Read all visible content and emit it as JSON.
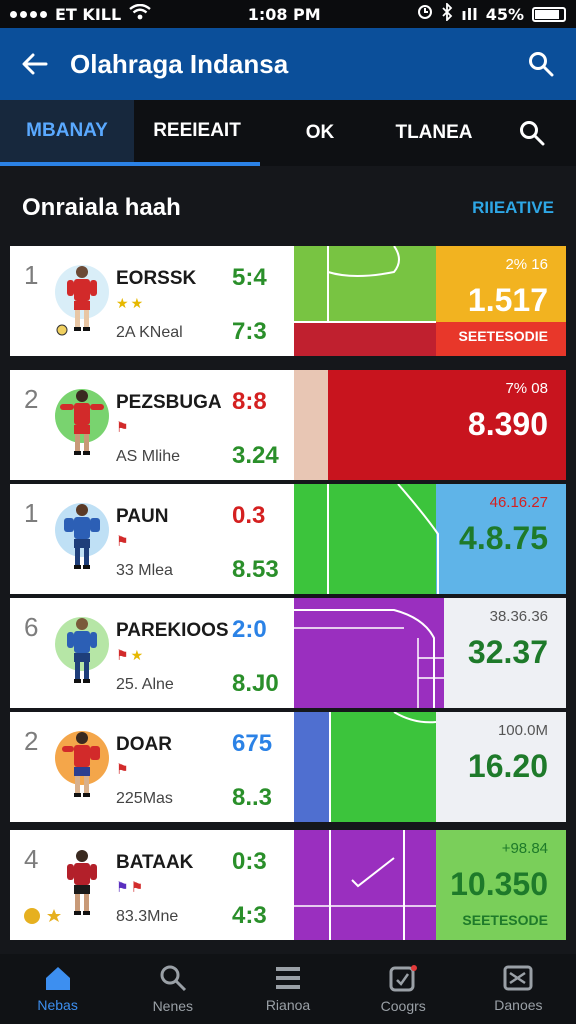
{
  "status_bar": {
    "carrier": "ET KILL",
    "time": "1:08 PM",
    "signal": "ıll",
    "battery": "45%"
  },
  "app_bar": {
    "title": "Olahraga Indansa"
  },
  "tabs": [
    {
      "label": "MBANAY"
    },
    {
      "label": "REEIEAIT"
    },
    {
      "label": "OK"
    },
    {
      "label": "TLANEA"
    }
  ],
  "section": {
    "title": "Onraiala haah",
    "link": "RIIEATIVE"
  },
  "cards": [
    {
      "rank": "1",
      "name": "EORSSK",
      "sub": "2A KNeal",
      "score1": "5:4",
      "score2": "7:3",
      "badges": [
        "★",
        "★"
      ],
      "right_top": "2% 16",
      "right_big": "1.517",
      "right_bottom": "SEETESODIE",
      "score1_color": "#2a8f2a",
      "avatar_bg": "#d9eef8",
      "shirt": "#d22a2a",
      "shorts": "#d22a2a"
    },
    {
      "rank": "2",
      "name": "PEZSBUGA",
      "sub": "AS Mlihe",
      "score1": "8:8",
      "score2": "3.24",
      "badges": [
        "⚑"
      ],
      "right_top": "7% 08",
      "right_big": "8.390",
      "right_bottom": "",
      "score1_color": "#d42020",
      "avatar_bg": "#79d36f",
      "shirt": "#d22a2a",
      "shorts": "#d22a2a"
    },
    {
      "rank": "1",
      "name": "PAUN",
      "sub": "33 Mlea",
      "score1": "0.3",
      "score2": "8.53",
      "badges": [
        "⚑"
      ],
      "right_top": "46.16.27",
      "right_big": "4.8.75",
      "right_bottom": "",
      "score1_color": "#d42020",
      "avatar_bg": "#bfe0f5",
      "shirt": "#2c5fb5",
      "shorts": "#1e3e7a"
    },
    {
      "rank": "6",
      "name": "PAREKIOOS",
      "sub": "25. Alne",
      "score1": "2:0",
      "score2": "8.J0",
      "badges": [
        "⚑",
        "★"
      ],
      "right_top": "38.36.36",
      "right_big": "32.37",
      "right_bottom": "",
      "score1_color": "#2b82e6",
      "avatar_bg": "#b6e6a6",
      "shirt": "#2c5fb5",
      "shorts": "#1e3e7a"
    },
    {
      "rank": "2",
      "name": "DOAR",
      "sub": "225Mas",
      "score1": "675",
      "score2": "8..3",
      "badges": [
        "⚑"
      ],
      "right_top": "100.0M",
      "right_big": "16.20",
      "right_bottom": "",
      "score1_color": "#2b82e6",
      "avatar_bg": "#f4a64a",
      "shirt": "#d22a2a",
      "shorts": "#2c3e8f"
    },
    {
      "rank": "4",
      "name": "BATAAK",
      "sub": "83.3Mne",
      "score1": "0:3",
      "score2": "4:3",
      "badges": [
        "⚑",
        "⚑"
      ],
      "right_top": "+98.84",
      "right_big": "10.350",
      "right_bottom": "SEETESODE",
      "score1_color": "#2a8f2a",
      "avatar_bg": "#ffffff",
      "shirt": "#b3202a",
      "shorts": "#1a1a1a"
    }
  ],
  "nav": [
    {
      "label": "Nebas"
    },
    {
      "label": "Nenes"
    },
    {
      "label": "Rianoa"
    },
    {
      "label": "Coogrs"
    },
    {
      "label": "Danoes"
    }
  ],
  "colors": {
    "appbar": "#0b4f9a",
    "accent": "#2b82e6",
    "score_green": "#2a8f2a",
    "score_red": "#d42020"
  }
}
